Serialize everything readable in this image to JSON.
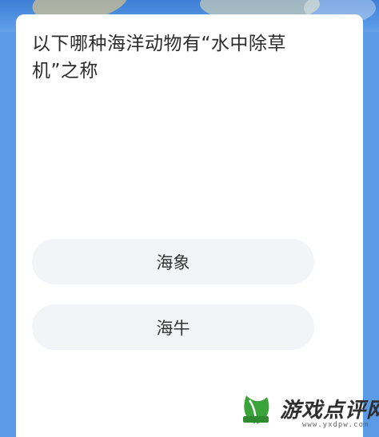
{
  "question": {
    "text": "以下哪种海洋动物有“水中除草机”之称"
  },
  "options": [
    {
      "label": "海象"
    },
    {
      "label": "海牛"
    }
  ],
  "watermark": {
    "brand": "游戏点评网",
    "url": "www.yxdpw.com",
    "icon": "leaf-logo-icon"
  },
  "colors": {
    "background": "#4f8fe0",
    "card": "#ffffff",
    "option_bg": "#f2f4f7",
    "text": "#2b2b2b",
    "logo_green": "#3aa33a"
  }
}
